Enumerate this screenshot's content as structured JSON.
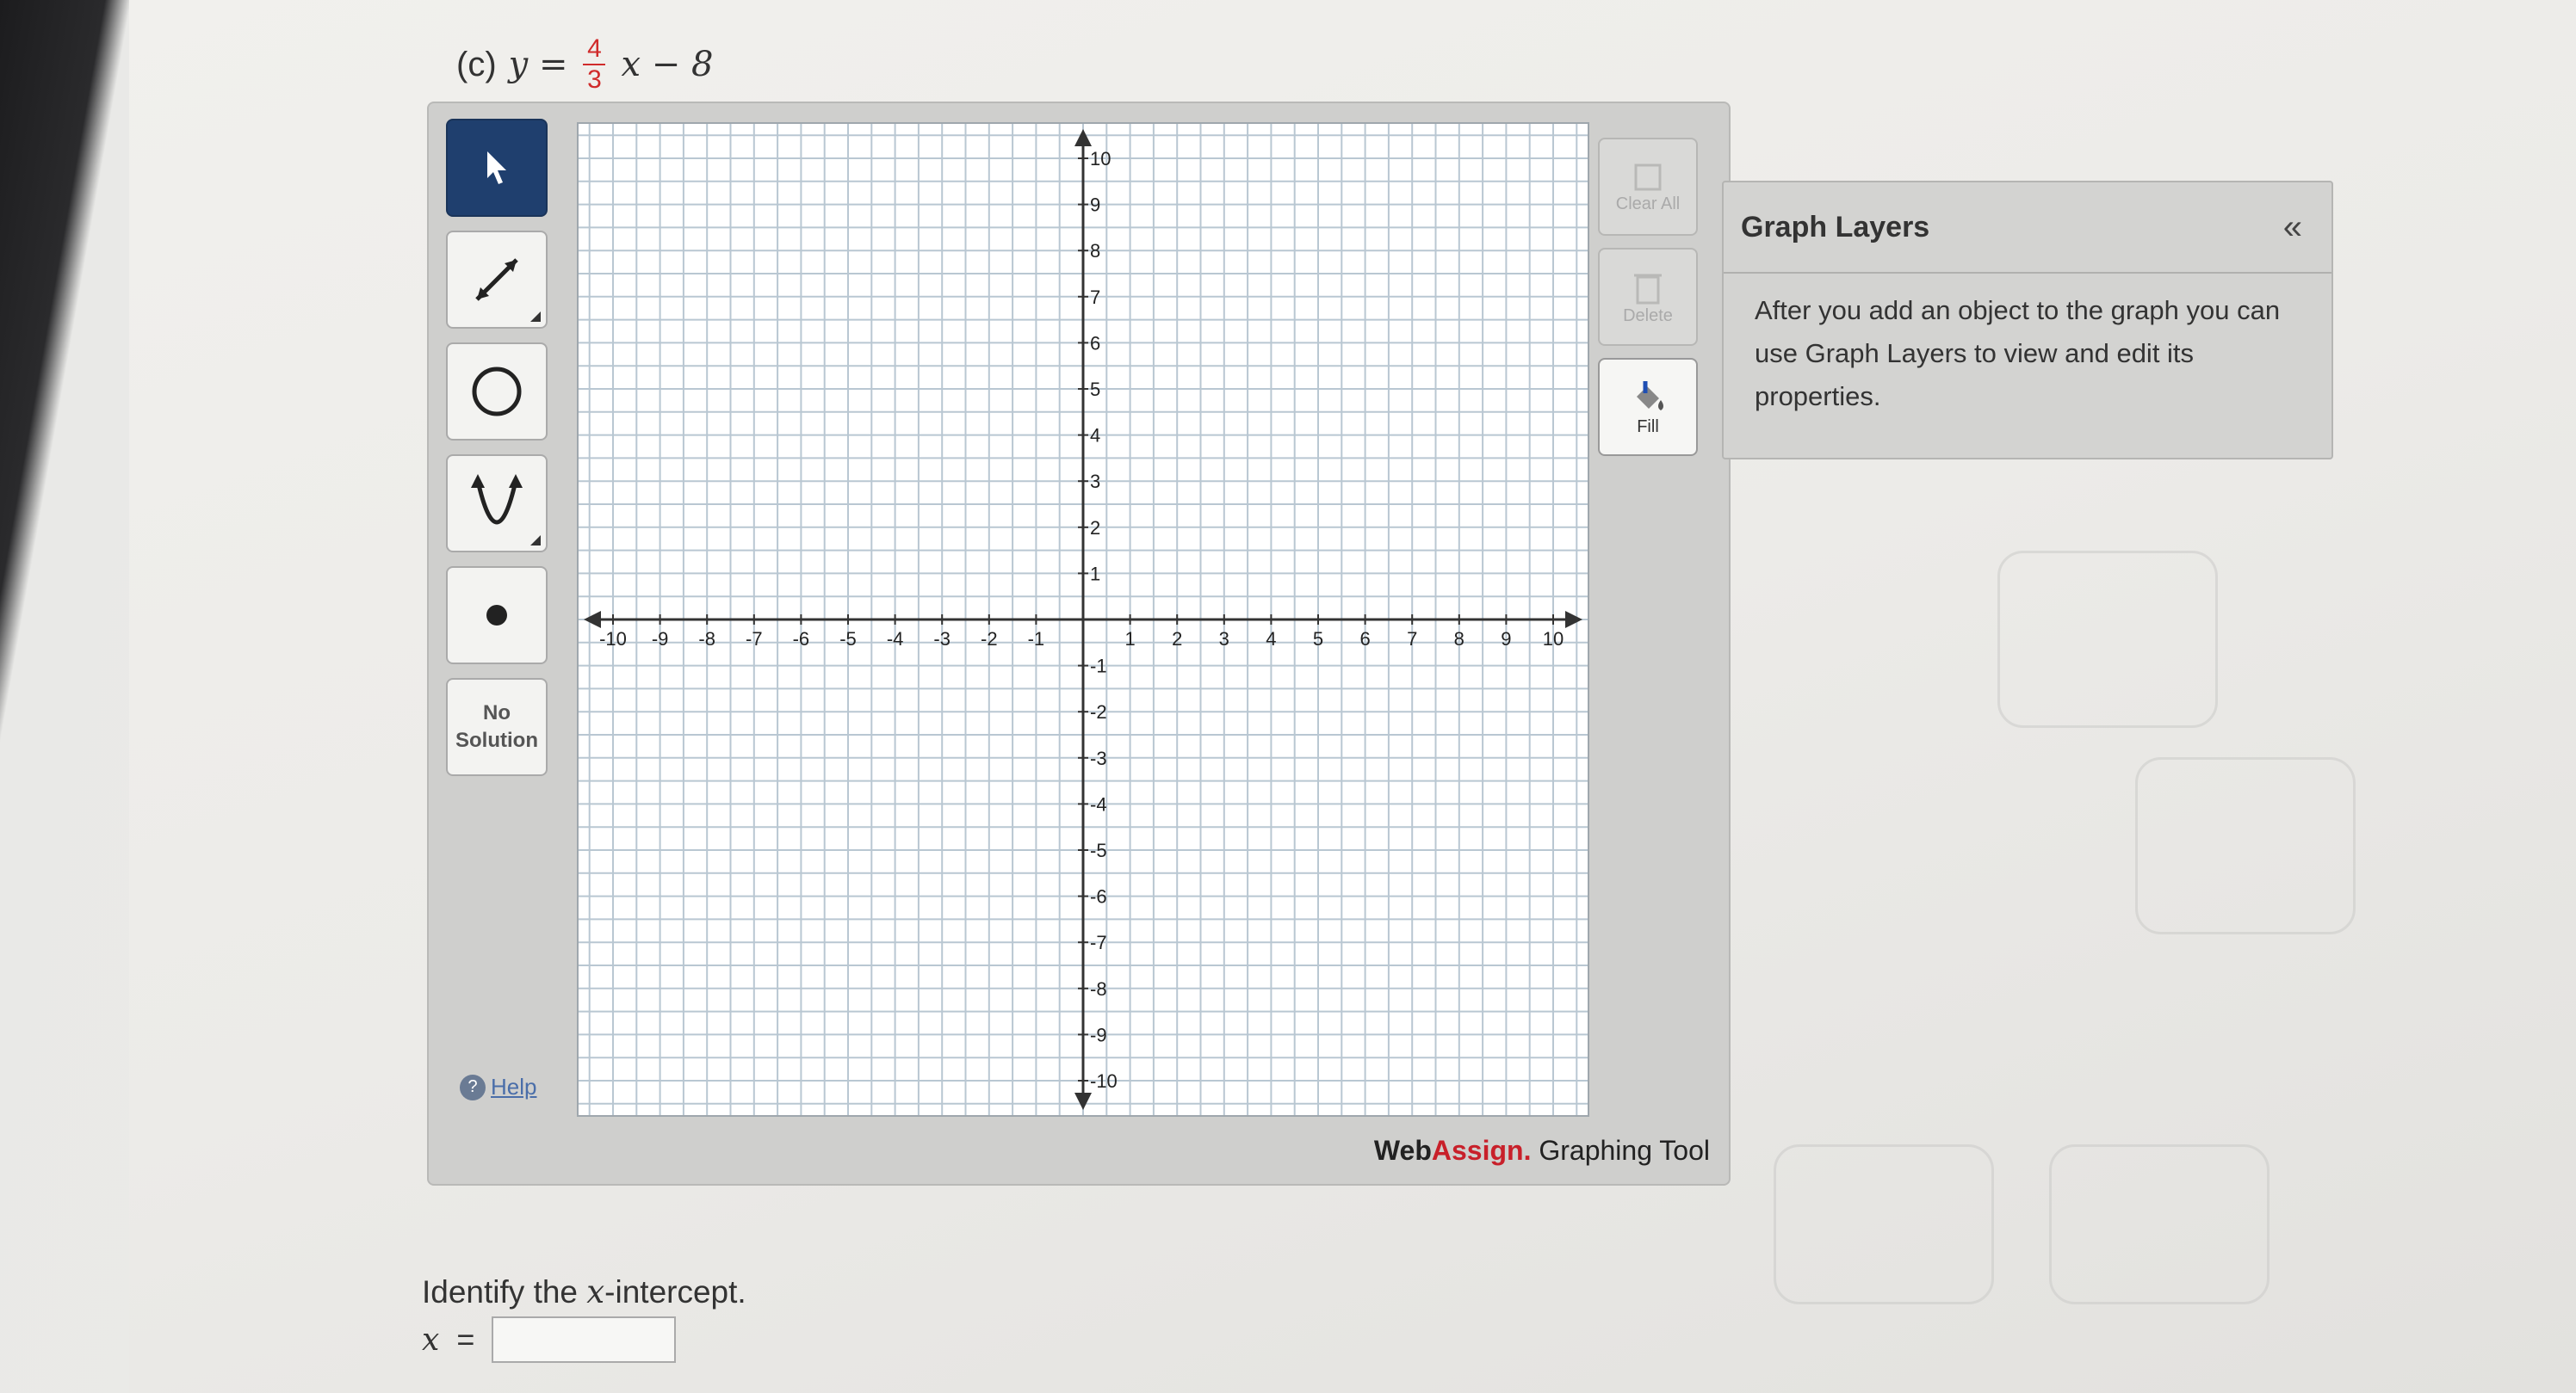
{
  "problem": {
    "part_label": "(c)",
    "equation_lhs": "y =",
    "slope_numerator": "4",
    "slope_denominator": "3",
    "equation_rest": "x − 8"
  },
  "toolbar": {
    "items": [
      {
        "name": "pointer-tool",
        "icon": "arrow-pointer-icon",
        "selected": true
      },
      {
        "name": "line-tool",
        "icon": "line-segment-icon"
      },
      {
        "name": "circle-tool",
        "icon": "circle-icon"
      },
      {
        "name": "parabola-tool",
        "icon": "parabola-icon"
      },
      {
        "name": "point-tool",
        "icon": "point-icon"
      }
    ],
    "no_solution_line1": "No",
    "no_solution_line2": "Solution",
    "help_label": "Help"
  },
  "graph": {
    "x_range": [
      -10,
      10
    ],
    "y_range": [
      -10,
      10
    ],
    "grid": true,
    "x_tick_labels": [
      "-10",
      "-9",
      "-8",
      "-7",
      "-6",
      "-5",
      "-4",
      "-3",
      "-2",
      "-1",
      "1",
      "2",
      "3",
      "4",
      "5",
      "6",
      "7",
      "8",
      "9",
      "10"
    ],
    "y_tick_labels": [
      "10",
      "9",
      "8",
      "7",
      "6",
      "5",
      "4",
      "3",
      "2",
      "1",
      "-1",
      "-2",
      "-3",
      "-4",
      "-5",
      "-6",
      "-7",
      "-8",
      "-9",
      "-10"
    ]
  },
  "right_tools": {
    "clear_label": "Clear All",
    "delete_label": "Delete",
    "fill_label": "Fill"
  },
  "branding": {
    "web": "Web",
    "assign": "Assign.",
    "rest": " Graphing Tool"
  },
  "layers": {
    "title": "Graph Layers",
    "collapse_glyph": "«",
    "description": "After you add an object to the graph you can use Graph Layers to view and edit its properties."
  },
  "question": {
    "prompt_before": "Identify the ",
    "prompt_var": "x",
    "prompt_after": "-intercept.",
    "answer_var": "x",
    "answer_eq": "=",
    "answer_value": ""
  },
  "colors": {
    "accent_red": "#d02b2b",
    "active_tool_blue": "#1f3f6e",
    "brand_red": "#c8202a"
  }
}
